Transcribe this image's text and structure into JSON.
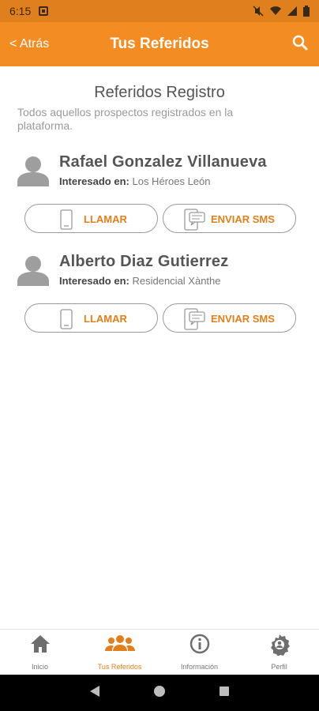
{
  "status_bar": {
    "time": "6:15"
  },
  "app_bar": {
    "back_label": "< Atrás",
    "title": "Tus Referidos"
  },
  "section": {
    "title": "Referidos Registro",
    "subtitle": "Todos aquellos prospectos registrados en la plataforma."
  },
  "referrals": [
    {
      "name": "Rafael Gonzalez Villanueva",
      "interest_label": "Interesado en:",
      "interest_value": "Los Héroes León",
      "call_label": "LLAMAR",
      "sms_label": "ENVIAR SMS"
    },
    {
      "name": "Alberto Diaz Gutierrez",
      "interest_label": "Interesado en:",
      "interest_value": "Residencial Xànthe",
      "call_label": "LLAMAR",
      "sms_label": "ENVIAR SMS"
    }
  ],
  "bottom_nav": [
    {
      "label": "Inicio",
      "icon": "home-icon"
    },
    {
      "label": "Tus Referidos",
      "icon": "group-icon"
    },
    {
      "label": "Información",
      "icon": "info-icon"
    },
    {
      "label": "Perfil",
      "icon": "settings-icon"
    }
  ],
  "colors": {
    "accent": "#F28C23",
    "accent_text": "#E07F1D"
  }
}
